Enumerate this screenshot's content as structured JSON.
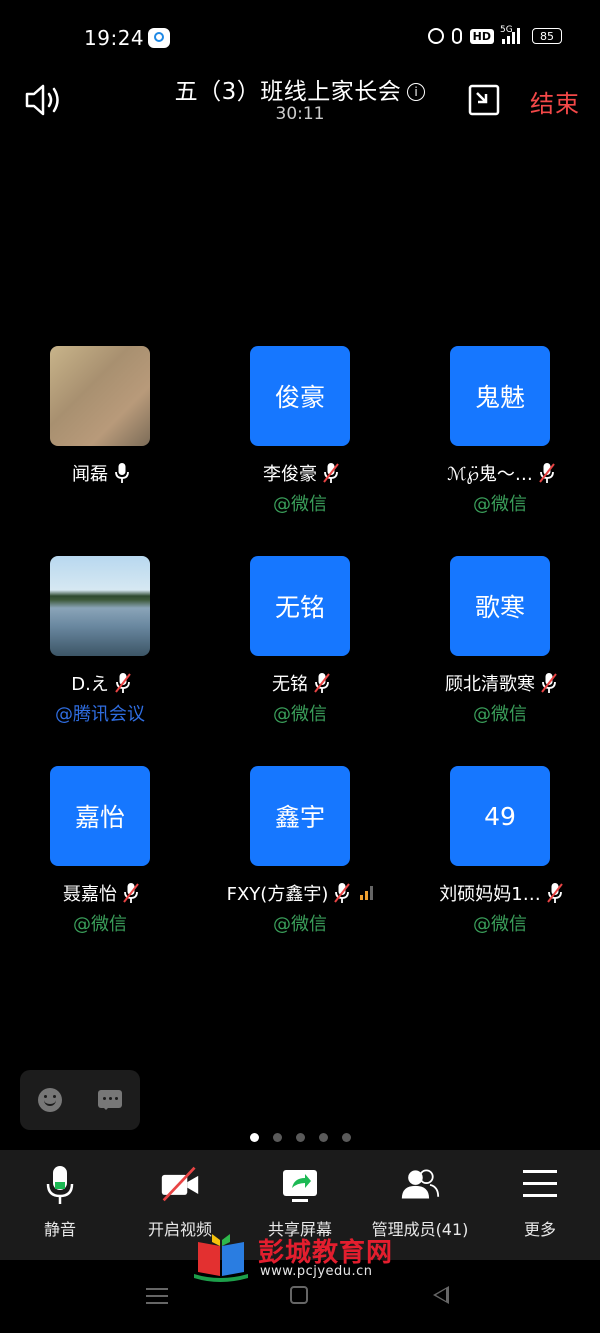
{
  "status_bar": {
    "time": "19:24",
    "network": "5G",
    "hd": "HD",
    "battery": "85"
  },
  "header": {
    "title": "五（3）班线上家长会",
    "info_icon": "ⓘ",
    "duration": "30:11",
    "end_label": "结束"
  },
  "participants": [
    {
      "avatar_text": "",
      "name": "闻磊",
      "muted": false,
      "source": "",
      "avatar_type": "image"
    },
    {
      "avatar_text": "俊豪",
      "name": "李俊豪",
      "muted": true,
      "source": "@微信"
    },
    {
      "avatar_text": "鬼魅",
      "name": "ℳ℘̈鬼～…",
      "muted": true,
      "source": "@微信"
    },
    {
      "avatar_text": "",
      "name": "D.え",
      "muted": true,
      "source": "@腾讯会议",
      "avatar_type": "image"
    },
    {
      "avatar_text": "无铭",
      "name": "无铭",
      "muted": true,
      "source": "@微信"
    },
    {
      "avatar_text": "歌寒",
      "name": "顾北清歌寒",
      "muted": true,
      "source": "@微信"
    },
    {
      "avatar_text": "嘉怡",
      "name": "聂嘉怡",
      "muted": true,
      "source": "@微信"
    },
    {
      "avatar_text": "鑫宇",
      "name": "FXY(方鑫宇)",
      "muted": true,
      "source": "@微信"
    },
    {
      "avatar_text": "49",
      "name": "刘硕妈妈1…",
      "muted": true,
      "source": "@微信"
    }
  ],
  "pagination": {
    "total": 5,
    "active": 0
  },
  "toolbar": {
    "mute": "静音",
    "video": "开启视频",
    "share": "共享屏幕",
    "members": "管理成员(41)",
    "more": "更多"
  },
  "watermark": {
    "brand": "彭城教育网",
    "url": "www.pcjyedu.cn"
  },
  "colors": {
    "accent": "#1677ff",
    "end": "#f44848",
    "wechat": "#3a9e5a",
    "tencent": "#2f6de0"
  }
}
